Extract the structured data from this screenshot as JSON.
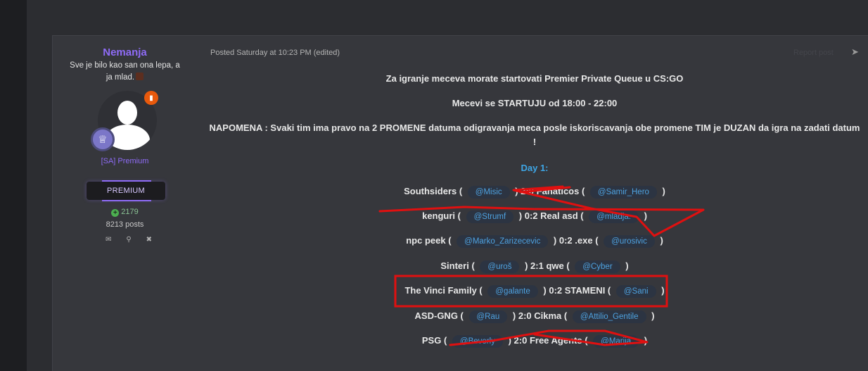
{
  "author": {
    "name": "Nemanja",
    "title": "Sve je bilo kao san ona lepa, a ja mlad.",
    "group": "[SA] Premium",
    "premium_badge": "PREMIUM",
    "reputation": "2179",
    "posts": "8213 posts"
  },
  "post": {
    "meta": "Posted Saturday at 10:23 PM (edited)",
    "report": "Report post",
    "intro_line1": "Za igranje meceva morate startovati Premier Private Queue u CS:GO",
    "intro_line2": "Mecevi se STARTUJU od 18:00 - 22:00",
    "note": "NAPOMENA : Svaki tim ima pravo na 2 PROMENE datuma  odigravanja meca posle iskoriscavanja obe promene TIM je DUZAN da igra na zadati datum !",
    "day": "Day 1:"
  },
  "matches": [
    {
      "team1": "Southsiders",
      "mention1": "@Misic",
      "score": "2:0",
      "team2": "Fanaticos",
      "mention2": "@Samir_Hero"
    },
    {
      "team1": "kenguri",
      "mention1": "@Strumf",
      "score": "0:2",
      "team2": "Real asd",
      "mention2": "@mladja."
    },
    {
      "team1": "npc peek",
      "mention1": "@Marko_Zarizecevic",
      "score": "0:2",
      "team2": ".exe",
      "mention2": "@urosivic"
    },
    {
      "team1": "Sinteri",
      "mention1": "@uroš",
      "score": "2:1",
      "team2": "qwe",
      "mention2": "@Cyber"
    },
    {
      "team1": "The Vinci Family",
      "mention1": "@galante",
      "score": "0:2",
      "team2": "STAMENI",
      "mention2": "@Sani"
    },
    {
      "team1": "ASD-GNG",
      "mention1": "@Rau",
      "score": "2:0",
      "team2": "Cikma",
      "mention2": "@Attilio_Gentile"
    },
    {
      "team1": "PSG",
      "mention1": "@Beverly",
      "score": "2:0",
      "team2": "Free Agents",
      "mention2": "@Marija"
    }
  ],
  "colors": {
    "accent": "#8f6cf7",
    "mention": "#4ea2e0",
    "annotation": "#e01010"
  },
  "icons": {
    "message": "envelope-icon",
    "search": "search-icon",
    "ignore": "close-circle-icon",
    "share": "share-icon",
    "rank": "crown-icon"
  }
}
